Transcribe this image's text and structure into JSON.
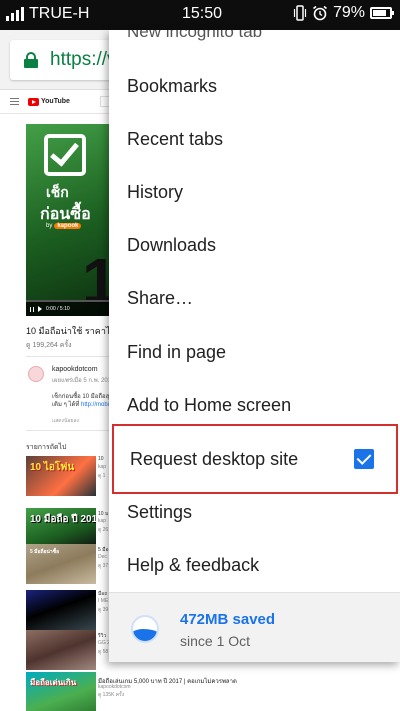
{
  "status_bar": {
    "carrier": "TRUE-H",
    "time": "15:50",
    "battery": "79%",
    "battery_level": 0.79,
    "icons": [
      "signal-icon",
      "vibrate-icon",
      "alarm-icon",
      "battery-icon"
    ]
  },
  "url_bar": {
    "url": "https://v",
    "secure_icon": "lock-icon",
    "secure_color": "#0b8043"
  },
  "background_page": {
    "logo": "YouTube",
    "video": {
      "overlay_line1": "เช็ก",
      "overlay_line2": "ก่อนซื้อ",
      "overlay_by": "by",
      "overlay_brand": "kapook",
      "overlay_big": "1",
      "time": "0:00 / 5:10"
    },
    "video_title": "10 มือถือน่าใช้ ราคาไม่เกิน",
    "views": "ดู 199,264 ครั้ง",
    "channel": {
      "name": "kapookdotcom",
      "date": "เผยแพร่เมื่อ 5 ก.พ. 2017",
      "desc_line1": "เช็กก่อนซื้อ 10 มือถือสุดคุ้",
      "desc_line2": "เติม ๆ ได้ที่",
      "desc_link": "http://mobile",
      "show_less": "แสดงน้อยลง"
    },
    "up_next": "รายการถัดไป",
    "related": [
      {
        "caption": "10 ไอโฟน",
        "meta": [
          "10",
          "kap",
          "ดู 1"
        ]
      },
      {
        "caption": "10 มือถือ ปี 2017",
        "meta": [
          "10 ม",
          "kap",
          "ดู 26"
        ]
      },
      {
        "caption": "5 มือถือน่าซื้อ",
        "meta": [
          "5 มือ",
          "Dec",
          "ดู 37"
        ]
      },
      {
        "caption": "",
        "meta": [
          "มือถ",
          "I ME",
          "ดู 39"
        ]
      },
      {
        "caption": "",
        "meta": [
          "รีวิว",
          "GG 2",
          "ดู 58"
        ]
      }
    ],
    "last_item": {
      "caption": "มือถือเด่นเกิน",
      "title": "มือถือเล่นเกม 5,000 บาท ปี 2017 | คอเกมไม่ควรพลาด",
      "channel": "kapookdotcom",
      "views": "ดู 135K ครั้ง"
    }
  },
  "menu": {
    "partial_item": "New incognito tab",
    "items": [
      {
        "label": "Bookmarks"
      },
      {
        "label": "Recent tabs"
      },
      {
        "label": "History"
      },
      {
        "label": "Downloads"
      },
      {
        "label": "Share…"
      },
      {
        "label": "Find in page"
      },
      {
        "label": "Add to Home screen"
      },
      {
        "label": "Request desktop site",
        "checked": true
      },
      {
        "label": "Settings"
      },
      {
        "label": "Help & feedback"
      }
    ],
    "data_saver": {
      "saved": "472MB saved",
      "since": "since 1 Oct",
      "icon": "data-saver-icon"
    },
    "accent_color": "#1a73e8",
    "highlight_color": "#d32f2f"
  }
}
